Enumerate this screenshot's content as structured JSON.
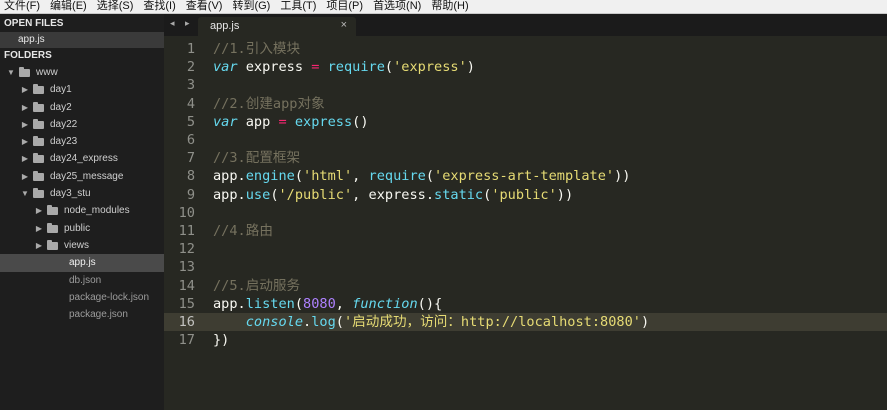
{
  "menu": [
    "文件(F)",
    "编辑(E)",
    "选择(S)",
    "查找(I)",
    "查看(V)",
    "转到(G)",
    "工具(T)",
    "项目(P)",
    "首选项(N)",
    "帮助(H)"
  ],
  "sidebar": {
    "open_files_header": "OPEN FILES",
    "open_files": [
      "app.js"
    ],
    "folders_header": "FOLDERS",
    "tree": [
      {
        "label": "www",
        "type": "folder",
        "depth": 0,
        "expanded": true,
        "active": false
      },
      {
        "label": "day1",
        "type": "folder",
        "depth": 1,
        "expanded": false,
        "active": false
      },
      {
        "label": "day2",
        "type": "folder",
        "depth": 1,
        "expanded": false,
        "active": false
      },
      {
        "label": "day22",
        "type": "folder",
        "depth": 1,
        "expanded": false,
        "active": false
      },
      {
        "label": "day23",
        "type": "folder",
        "depth": 1,
        "expanded": false,
        "active": false
      },
      {
        "label": "day24_express",
        "type": "folder",
        "depth": 1,
        "expanded": false,
        "active": false
      },
      {
        "label": "day25_message",
        "type": "folder",
        "depth": 1,
        "expanded": false,
        "active": false
      },
      {
        "label": "day3_stu",
        "type": "folder",
        "depth": 1,
        "expanded": true,
        "active": false
      },
      {
        "label": "node_modules",
        "type": "folder",
        "depth": 2,
        "expanded": false,
        "active": false
      },
      {
        "label": "public",
        "type": "folder",
        "depth": 2,
        "expanded": false,
        "active": false
      },
      {
        "label": "views",
        "type": "folder",
        "depth": 2,
        "expanded": false,
        "active": false
      },
      {
        "label": "app.js",
        "type": "file",
        "depth": 2,
        "expanded": false,
        "active": true
      },
      {
        "label": "db.json",
        "type": "file",
        "depth": 2,
        "expanded": false,
        "active": false
      },
      {
        "label": "package-lock.json",
        "type": "file",
        "depth": 2,
        "expanded": false,
        "active": false
      },
      {
        "label": "package.json",
        "type": "file",
        "depth": 2,
        "expanded": false,
        "active": false
      }
    ]
  },
  "tabbar": {
    "nav_arrows": "◂ ▸",
    "active_tab": "app.js",
    "close_glyph": "×"
  },
  "editor": {
    "current_line": 16,
    "colors": {
      "comment": "#75715e",
      "keyword": "#66d9ef",
      "string": "#e6db74",
      "number": "#ae81ff",
      "operator": "#f92672",
      "plain": "#f8f8f2",
      "background": "#272822"
    },
    "lines": [
      {
        "n": "1",
        "tokens": [
          [
            "cm",
            "//1.引入模块"
          ]
        ]
      },
      {
        "n": "2",
        "tokens": [
          [
            "kw",
            "var"
          ],
          [
            "pl",
            " express "
          ],
          [
            "op",
            "="
          ],
          [
            "pl",
            " "
          ],
          [
            "fn",
            "require"
          ],
          [
            "pl",
            "("
          ],
          [
            "str",
            "'express'"
          ],
          [
            "pl",
            ")"
          ]
        ]
      },
      {
        "n": "3",
        "tokens": []
      },
      {
        "n": "4",
        "tokens": [
          [
            "cm",
            "//2.创建app对象"
          ]
        ]
      },
      {
        "n": "5",
        "tokens": [
          [
            "kw",
            "var"
          ],
          [
            "pl",
            " app "
          ],
          [
            "op",
            "="
          ],
          [
            "pl",
            " "
          ],
          [
            "fn",
            "express"
          ],
          [
            "pl",
            "()"
          ]
        ]
      },
      {
        "n": "6",
        "tokens": []
      },
      {
        "n": "7",
        "tokens": [
          [
            "cm",
            "//3.配置框架"
          ]
        ]
      },
      {
        "n": "8",
        "tokens": [
          [
            "pl",
            "app."
          ],
          [
            "fn",
            "engine"
          ],
          [
            "pl",
            "("
          ],
          [
            "str",
            "'html'"
          ],
          [
            "pl",
            ", "
          ],
          [
            "fn",
            "require"
          ],
          [
            "pl",
            "("
          ],
          [
            "str",
            "'express-art-template'"
          ],
          [
            "pl",
            "))"
          ]
        ]
      },
      {
        "n": "9",
        "tokens": [
          [
            "pl",
            "app."
          ],
          [
            "fn",
            "use"
          ],
          [
            "pl",
            "("
          ],
          [
            "str",
            "'/public'"
          ],
          [
            "pl",
            ", express."
          ],
          [
            "fn",
            "static"
          ],
          [
            "pl",
            "("
          ],
          [
            "str",
            "'public'"
          ],
          [
            "pl",
            "))"
          ]
        ]
      },
      {
        "n": "10",
        "tokens": []
      },
      {
        "n": "11",
        "tokens": [
          [
            "cm",
            "//4.路由"
          ]
        ]
      },
      {
        "n": "12",
        "tokens": []
      },
      {
        "n": "13",
        "tokens": []
      },
      {
        "n": "14",
        "tokens": [
          [
            "cm",
            "//5.启动服务"
          ]
        ]
      },
      {
        "n": "15",
        "tokens": [
          [
            "pl",
            "app."
          ],
          [
            "fn",
            "listen"
          ],
          [
            "pl",
            "("
          ],
          [
            "num",
            "8080"
          ],
          [
            "pl",
            ", "
          ],
          [
            "kw",
            "function"
          ],
          [
            "pl",
            "(){"
          ]
        ]
      },
      {
        "n": "16",
        "tokens": [
          [
            "pl",
            "    "
          ],
          [
            "kw",
            "console"
          ],
          [
            "pl",
            "."
          ],
          [
            "fn",
            "log"
          ],
          [
            "pl",
            "("
          ],
          [
            "str",
            "'启动成功，访问：http://localhost:8080'"
          ],
          [
            "pl",
            ")"
          ]
        ]
      },
      {
        "n": "17",
        "tokens": [
          [
            "pl",
            "})"
          ]
        ]
      }
    ]
  }
}
